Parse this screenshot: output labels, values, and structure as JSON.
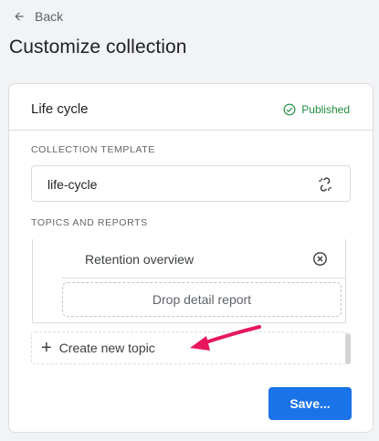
{
  "nav": {
    "back_label": "Back"
  },
  "page": {
    "title": "Customize collection"
  },
  "collection": {
    "name": "Life cycle",
    "status": "Published",
    "status_color": "#1e8e3e",
    "template_section_label": "COLLECTION TEMPLATE",
    "template_value": "life-cycle",
    "topics_section_label": "TOPICS AND REPORTS",
    "reports": [
      {
        "label": "Retention overview",
        "icon": "remove-circle-icon"
      }
    ],
    "drop_zone_label": "Drop detail report",
    "create_topic_label": "Create new topic"
  },
  "actions": {
    "save_label": "Save..."
  },
  "colors": {
    "accent": "#1a73e8",
    "annotation_arrow": "#e8175d"
  },
  "icons": [
    "back-arrow-icon",
    "check-circle-icon",
    "unlink-icon",
    "remove-circle-icon",
    "plus-icon"
  ]
}
